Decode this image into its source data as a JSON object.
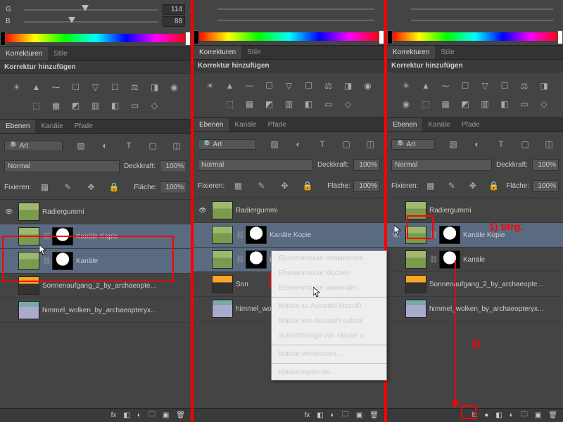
{
  "color": {
    "gLabel": "G",
    "gVal": "114",
    "bLabel": "B",
    "bVal": "88"
  },
  "tabsA": {
    "t1": "Korrekturen",
    "t2": "Stile",
    "sub": "Korrektur hinzufügen"
  },
  "tabsB": {
    "t1": "Ebenen",
    "t2": "Kanäle",
    "t3": "Pfade"
  },
  "search": "Art",
  "blend": {
    "mode": "Normal",
    "opLabel": "Deckkraft:",
    "opVal": "100%",
    "opVal3": "100%"
  },
  "lock": {
    "label": "Fixieren:",
    "fillLabel": "Fläche:",
    "fillVal": "100%",
    "fillVal3": "100%"
  },
  "layers": {
    "l1": "Radiergummi",
    "l2": "Kanäle Kopie",
    "l3": "Kanäle",
    "l4": "Sonnenaufgang_2_by_archaeopte...",
    "l4b": "Son",
    "l5": "himmel_wolken_by_archaeopteryx...",
    "l4c": "Sonnenaufgang_2_by_archaeopte...",
    "l5c": "himmel_wolken_by_archaeopteryx..."
  },
  "ctx": {
    "i1": "Ebenenmaske deaktivieren",
    "i2": "Ebenenmaske löschen",
    "i3": "Ebenenmaske anwenden",
    "i4": "Maske zu Auswahl hinzufü",
    "i5": "Maske von Auswahl subtra",
    "i6": "Schnittmenge von Maske u",
    "i7": "Maske verbessern...",
    "i8": "Maskenoptionen..."
  },
  "anno": {
    "a1": "1) Strg.",
    "a2": "2)"
  },
  "bicons": {
    "fx": "fx",
    "dot": "●",
    "mask": "◧",
    "adj": "◐",
    "grp": "🗀",
    "new": "▣",
    "del": "🗑"
  }
}
